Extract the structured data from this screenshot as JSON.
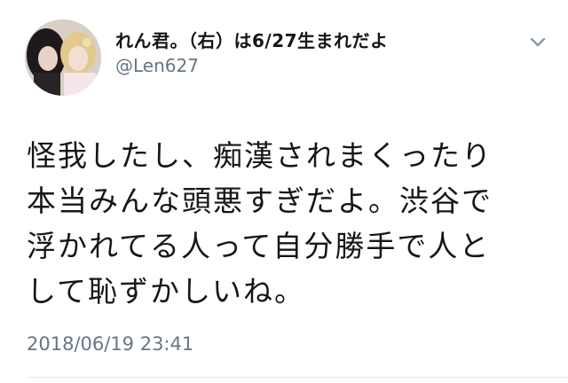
{
  "author": {
    "display_name": "れん君。（右）は6/27生まれだよ",
    "handle": "@Len627",
    "avatar_icon": "avatar-photo"
  },
  "menu": {
    "icon": "chevron-down-icon"
  },
  "tweet": {
    "lines": [
      "怪我したし、痴漢されまくったり",
      "本当みんな頭悪すぎだよ。渋谷で",
      "浮かれてる人って自分勝手で人と",
      "して恥ずかしいね。"
    ],
    "timestamp": "2018/06/19 23:41"
  },
  "colors": {
    "text_primary": "#14171a",
    "text_secondary": "#657786",
    "divider": "#e1e8ed"
  }
}
